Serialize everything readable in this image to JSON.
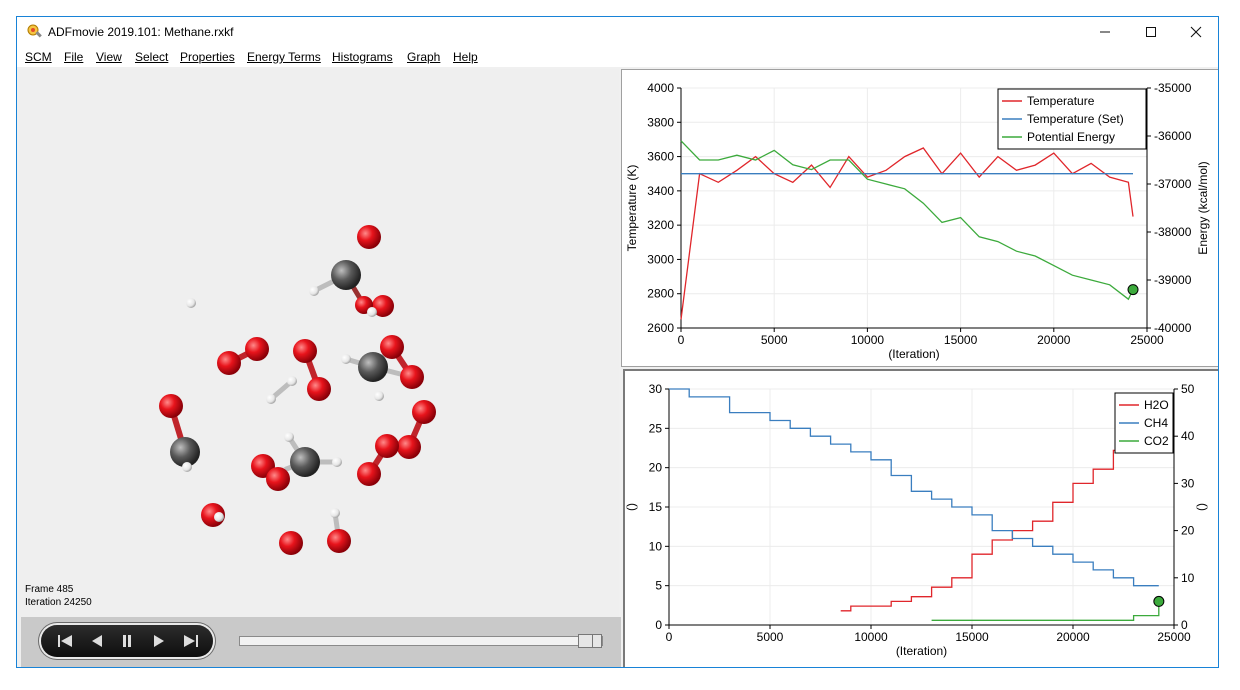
{
  "window": {
    "title": "ADFmovie 2019.101: Methane.rxkf",
    "controls": [
      "minimize-icon",
      "maximize-icon",
      "close-icon"
    ]
  },
  "menu": {
    "items": [
      "SCM",
      "File",
      "View",
      "Select",
      "Properties",
      "Energy Terms",
      "Histograms",
      "Graph",
      "Help"
    ]
  },
  "viewer": {
    "frame_label": "Frame 485",
    "iteration_label": "Iteration 24250",
    "slider_position": 0.97
  },
  "player": {
    "buttons": [
      "skip-to-start-icon",
      "step-back-icon",
      "pause-icon",
      "play-icon",
      "skip-to-end-icon"
    ]
  },
  "colors": {
    "red": "#e0262b",
    "blue": "#3a7ebf",
    "green": "#3caa3c",
    "oxygen": "#e8141c",
    "carbon": "#5a5a5a",
    "hydrogen": "#f2f2f2"
  },
  "chart_data": [
    {
      "type": "line",
      "x": [
        0,
        1000,
        2000,
        3000,
        4000,
        5000,
        6000,
        7000,
        8000,
        9000,
        10000,
        11000,
        12000,
        13000,
        14000,
        15000,
        16000,
        17000,
        18000,
        19000,
        20000,
        21000,
        22000,
        23000,
        24000,
        24250
      ],
      "xlabel": "(Iteration)",
      "ylabel_left": "Temperature (K)",
      "ylabel_right": "Energy (kcal/mol)",
      "xlim": [
        0,
        25000
      ],
      "xticks": [
        "0",
        "5000",
        "10000",
        "15000",
        "20000",
        "25000"
      ],
      "ylim_left": [
        2600,
        4000
      ],
      "yticks_left": [
        "4000",
        "3800",
        "3600",
        "3400",
        "3200",
        "3000",
        "2800",
        "2600"
      ],
      "ylim_right": [
        -40000,
        -35000
      ],
      "yticks_right": [
        "-35000",
        "-36000",
        "-37000",
        "-38000",
        "-39000",
        "-40000"
      ],
      "grid": true,
      "legend_position": "top-right",
      "series": [
        {
          "name": "Temperature",
          "axis": "left",
          "values": [
            2650,
            3500,
            3450,
            3520,
            3600,
            3500,
            3450,
            3550,
            3420,
            3600,
            3480,
            3520,
            3600,
            3650,
            3500,
            3620,
            3480,
            3600,
            3520,
            3550,
            3620,
            3500,
            3560,
            3480,
            3450,
            3250
          ]
        },
        {
          "name": "Temperature (Set)",
          "axis": "left",
          "values": [
            3500,
            3500,
            3500,
            3500,
            3500,
            3500,
            3500,
            3500,
            3500,
            3500,
            3500,
            3500,
            3500,
            3500,
            3500,
            3500,
            3500,
            3500,
            3500,
            3500,
            3500,
            3500,
            3500,
            3500,
            3500,
            3500
          ]
        },
        {
          "name": "Potential Energy",
          "axis": "right",
          "values": [
            -36100,
            -36500,
            -36500,
            -36400,
            -36500,
            -36300,
            -36600,
            -36700,
            -36500,
            -36500,
            -36900,
            -37000,
            -37100,
            -37400,
            -37800,
            -37700,
            -38100,
            -38200,
            -38400,
            -38500,
            -38700,
            -38900,
            -39000,
            -39100,
            -39400,
            -39200
          ]
        }
      ],
      "marker": {
        "x": 24250,
        "value": -39200,
        "axis": "right"
      }
    },
    {
      "type": "line",
      "x": [
        0,
        1000,
        2000,
        3000,
        4000,
        5000,
        6000,
        7000,
        8000,
        8500,
        9000,
        10000,
        11000,
        12000,
        13000,
        14000,
        15000,
        16000,
        17000,
        18000,
        19000,
        20000,
        21000,
        22000,
        23000,
        24250
      ],
      "xlabel": "(Iteration)",
      "ylabel_left": "()",
      "ylabel_right": "()",
      "xlim": [
        0,
        25000
      ],
      "xticks": [
        "0",
        "5000",
        "10000",
        "15000",
        "20000",
        "25000"
      ],
      "ylim_left": [
        0,
        30
      ],
      "yticks_left": [
        "30",
        "25",
        "20",
        "15",
        "10",
        "5",
        "0"
      ],
      "ylim_right": [
        0,
        50
      ],
      "yticks_right": [
        "50",
        "40",
        "30",
        "20",
        "10",
        "0"
      ],
      "grid": true,
      "legend_position": "top-right",
      "series": [
        {
          "name": "H2O",
          "axis": "right",
          "values": [
            null,
            null,
            null,
            null,
            null,
            null,
            null,
            null,
            null,
            3,
            4,
            4,
            5,
            6,
            8,
            10,
            15,
            18,
            20,
            22,
            26,
            30,
            33,
            37,
            40,
            42
          ]
        },
        {
          "name": "CH4",
          "axis": "left",
          "values": [
            30,
            29,
            29,
            27,
            27,
            26,
            25,
            24,
            23,
            23,
            22,
            21,
            19,
            17,
            16,
            15,
            14,
            12,
            11,
            10,
            9,
            8,
            7,
            6,
            5,
            5
          ]
        },
        {
          "name": "CO2",
          "axis": "right",
          "values": [
            null,
            null,
            null,
            null,
            null,
            null,
            null,
            null,
            null,
            null,
            null,
            null,
            null,
            null,
            1,
            1,
            1,
            1,
            1,
            1,
            1,
            1,
            1,
            1,
            2,
            5
          ]
        }
      ],
      "marker": {
        "x": 24250,
        "value": 5,
        "axis": "right"
      }
    }
  ]
}
